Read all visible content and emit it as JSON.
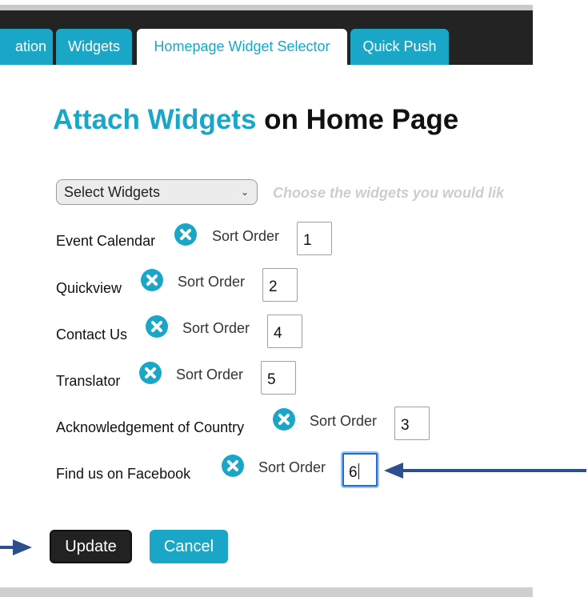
{
  "tabs": [
    {
      "label": "ation",
      "active": false
    },
    {
      "label": "Widgets",
      "active": false
    },
    {
      "label": "Homepage Widget Selector",
      "active": true
    },
    {
      "label": "Quick Push",
      "active": false
    }
  ],
  "heading": {
    "accent": "Attach Widgets",
    "rest": " on Home Page"
  },
  "select": {
    "value": "Select Widgets",
    "hint": "Choose the widgets you would lik"
  },
  "widgets": [
    {
      "name": "Event Calendar",
      "sort_label": "Sort Order",
      "order": "1"
    },
    {
      "name": "Quickview",
      "sort_label": "Sort Order",
      "order": "2"
    },
    {
      "name": "Contact Us",
      "sort_label": "Sort Order",
      "order": "4"
    },
    {
      "name": "Translator",
      "sort_label": "Sort Order",
      "order": "5"
    },
    {
      "name": "Acknowledgement of Country",
      "sort_label": "Sort Order",
      "order": "3"
    },
    {
      "name": "Find us on Facebook",
      "sort_label": "Sort Order",
      "order": "6",
      "focused": true
    }
  ],
  "actions": {
    "update": "Update",
    "cancel": "Cancel"
  },
  "icons": {
    "remove": "remove-x-circle-icon",
    "chevron": "chevron-down-icon",
    "annotation": "arrow-icon"
  },
  "colors": {
    "accent": "#1aa7c7",
    "tabbar": "#232323",
    "annotation_arrow": "#2e4f8e"
  }
}
